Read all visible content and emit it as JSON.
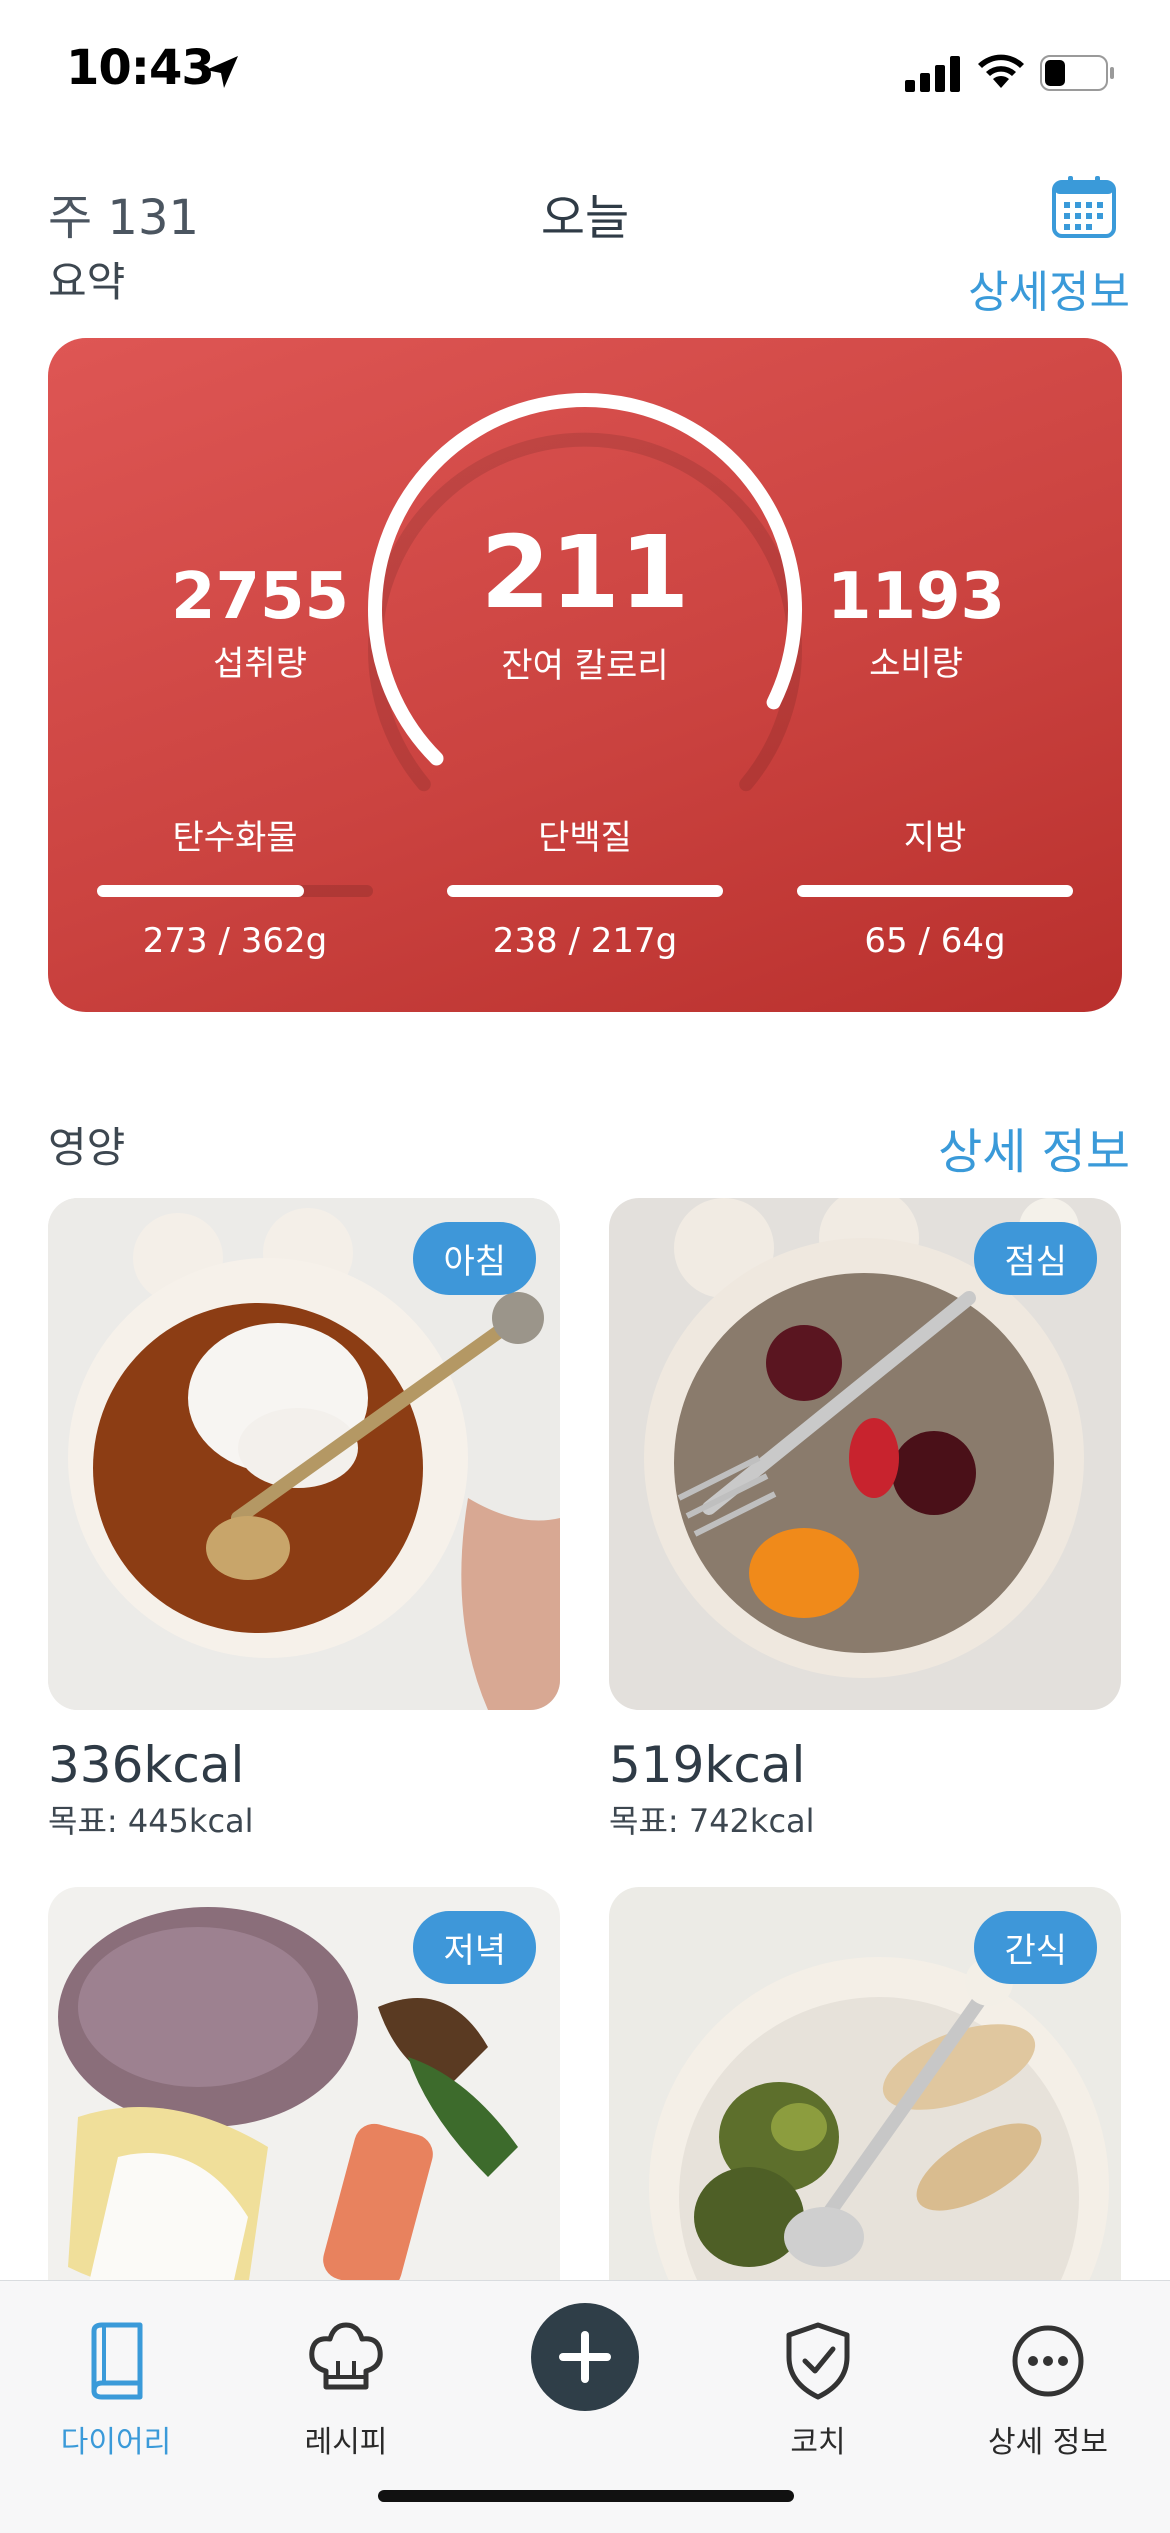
{
  "status_bar": {
    "time": "10:43",
    "battery_level": 0.35
  },
  "header": {
    "week_label": "주 131",
    "title": "오늘"
  },
  "summary": {
    "title": "요약",
    "link": "상세정보",
    "eaten": {
      "value": "2755",
      "label": "섭취량"
    },
    "remaining": {
      "value": "211",
      "label": "잔여 칼로리"
    },
    "burned": {
      "value": "1193",
      "label": "소비량"
    },
    "gauge_progress": 0.93,
    "macros": [
      {
        "name": "탄수화물",
        "value": "273 / 362g",
        "progress": 0.75
      },
      {
        "name": "단백질",
        "value": "238 / 217g",
        "progress": 1.0
      },
      {
        "name": "지방",
        "value": "65 / 64g",
        "progress": 1.0
      }
    ]
  },
  "nutrition": {
    "title": "영양",
    "link": "상세 정보",
    "meals": [
      {
        "tag": "아침",
        "kcal": "336kcal",
        "goal": "목표: 445kcal"
      },
      {
        "tag": "점심",
        "kcal": "519kcal",
        "goal": "목표: 742kcal"
      },
      {
        "tag": "저녁",
        "kcal": "",
        "goal": ""
      },
      {
        "tag": "간식",
        "kcal": "",
        "goal": ""
      }
    ]
  },
  "tabbar": {
    "items": [
      {
        "label": "다이어리",
        "icon": "book-icon",
        "active": true
      },
      {
        "label": "레시피",
        "icon": "chef-hat-icon"
      },
      {
        "label": "",
        "icon": "plus-icon"
      },
      {
        "label": "코치",
        "icon": "shield-check-icon"
      },
      {
        "label": "상세 정보",
        "icon": "more-icon"
      }
    ]
  },
  "colors": {
    "accent": "#3a9ad9",
    "card_red": "#cb4340",
    "fab": "#2f3e48"
  }
}
